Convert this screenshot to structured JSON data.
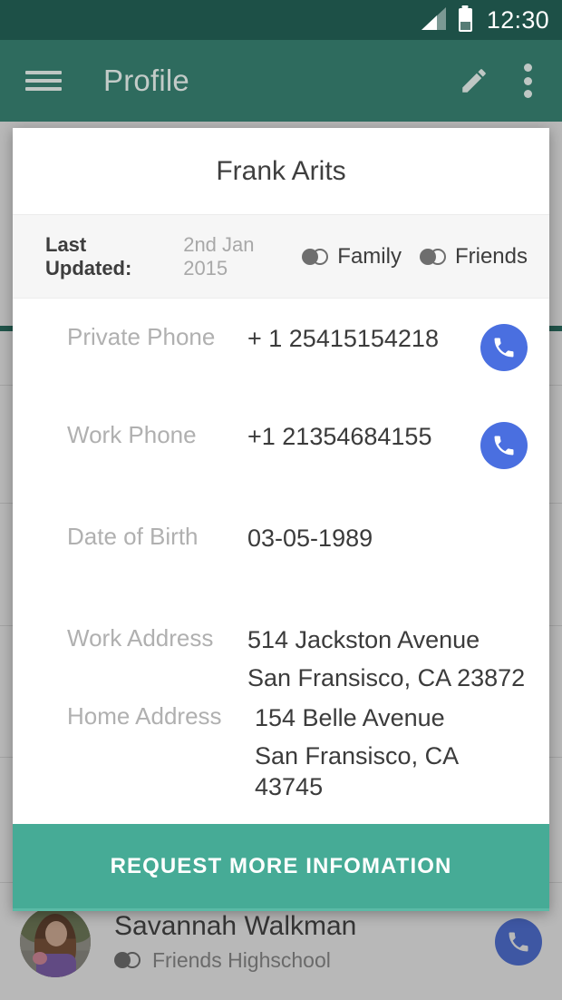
{
  "status_bar": {
    "time": "12:30",
    "signal_icon": "signal-bars-icon",
    "battery_icon": "battery-icon"
  },
  "app_bar": {
    "menu_icon": "hamburger-menu-icon",
    "title": "Profile",
    "edit_icon": "pencil-edit-icon",
    "overflow_icon": "more-vertical-icon",
    "background_color": "#2e6b5e"
  },
  "dialog": {
    "title": "Frank Arits",
    "meta": {
      "label": "Last Updated:",
      "value": "2nd Jan 2015",
      "tags": [
        {
          "label": "Family",
          "icon": "group-circles-icon"
        },
        {
          "label": "Friends",
          "icon": "group-circles-icon"
        }
      ]
    },
    "details": [
      {
        "label": "Private Phone",
        "value": "+ 1 25415154218",
        "action": "call-button"
      },
      {
        "label": "Work Phone",
        "value": "+1 21354684155",
        "action": "call-button"
      },
      {
        "label": "Date of Birth",
        "value": "03-05-1989",
        "action": null
      },
      {
        "label": "Work Address",
        "value": "514 Jackston Avenue",
        "value2": "San Fransisco, CA 23872",
        "action": null
      },
      {
        "label": "Home Address",
        "value": "154 Belle Avenue",
        "value2": "San Fransisco, CA 43745",
        "action": null
      }
    ],
    "action_button": {
      "label": "REQUEST MORE INFOMATION",
      "color": "#46ab96"
    }
  },
  "background_list": {
    "item": {
      "name": "Savannah Walkman",
      "tag_label": "Friends Highschool",
      "tag_icon": "group-circles-icon",
      "avatar": "contact-photo",
      "call_icon": "phone-handset-icon",
      "call_color": "#4a6fe0"
    }
  }
}
